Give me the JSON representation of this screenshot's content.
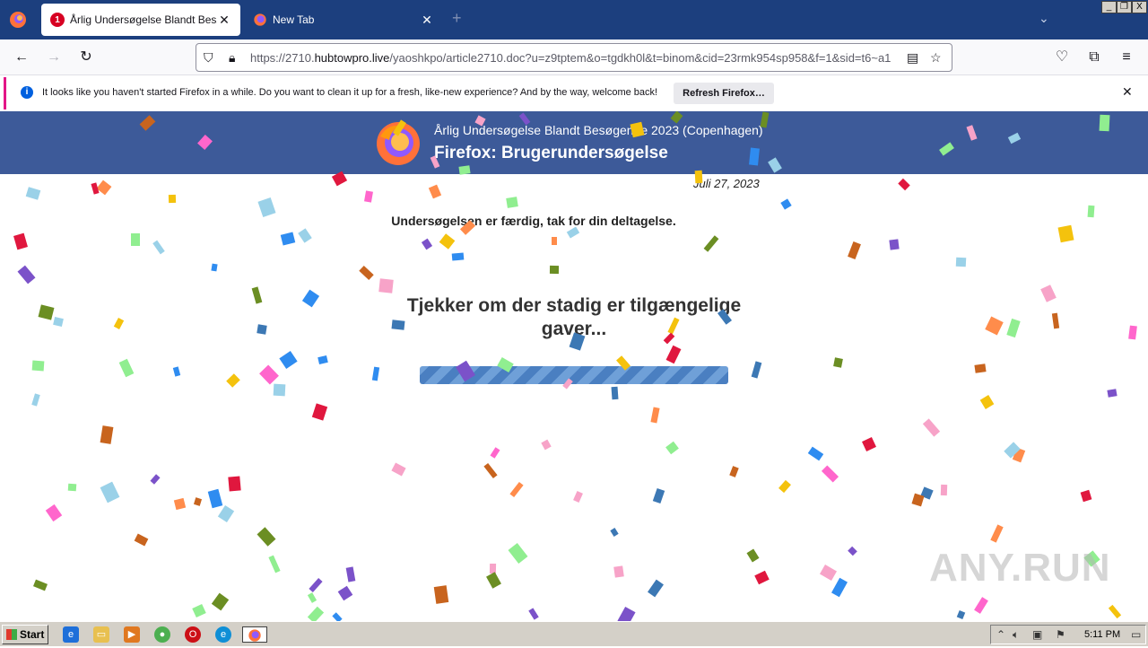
{
  "browser": {
    "tabs": [
      {
        "title": "Årlig Undersøgelse Blandt Besøgende 2023 (Copenhagen)",
        "badge": "1",
        "active": true
      },
      {
        "title": "New Tab",
        "active": false
      }
    ],
    "url_prefix": "https://2710.",
    "url_host": "hubtowpro.live",
    "url_path": "/yaoshkpo/article2710.doc?u=z9tptem&o=tgdkh0l&t=binom&cid=23rmk954sp958&f=1&sid=t6~a1",
    "window_controls": [
      "_",
      "❐",
      "X"
    ]
  },
  "notification": {
    "message": "It looks like you haven't started Firefox in a while. Do you want to clean it up for a fresh, like-new experience? And by the way, welcome back!",
    "button_label": "Refresh Firefox…",
    "accent_color": "#e31587"
  },
  "page": {
    "banner_color": "#3d5a99",
    "subtitle": "Årlig Undersøgelse Blandt Besøgende 2023 (Copenhagen)",
    "title": "Firefox: Brugerundersøgelse",
    "date": "Juli 27, 2023",
    "done_text": "Undersøgelsen er færdig, tak for din deltagelse.",
    "checking_text": "Tjekker om der stadig er tilgængelige gaver...",
    "watermark": "ANY.RUN"
  },
  "taskbar": {
    "start_label": "Start",
    "clock": "5:11 PM"
  }
}
